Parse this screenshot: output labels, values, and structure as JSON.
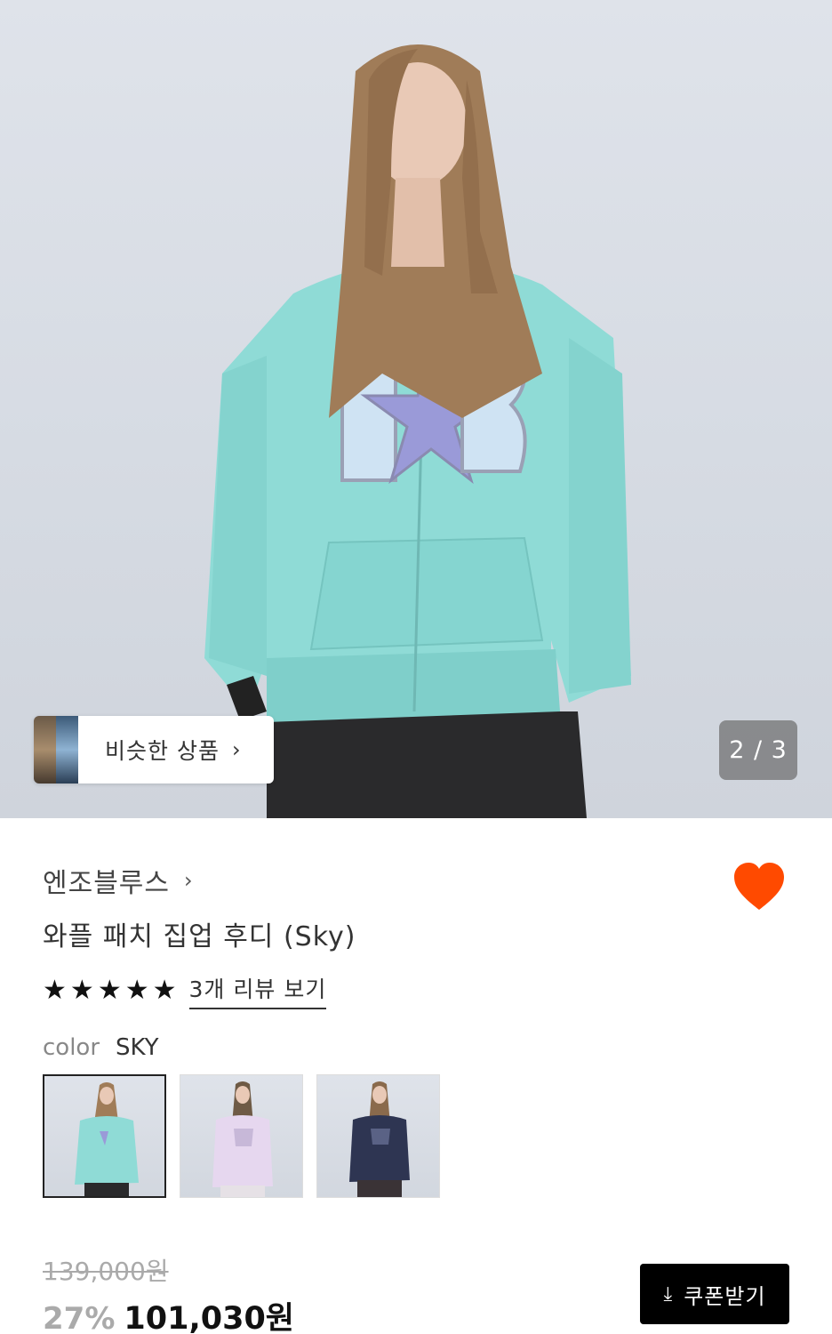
{
  "hero": {
    "similar_label": "비슷한 상품",
    "counter": "2 / 3",
    "icons": {
      "chevron": "chevron-right-icon"
    }
  },
  "product": {
    "brand": "엔조블루스",
    "name": "와플 패치 집업 후디 (Sky)",
    "rating_stars": 5,
    "review_link": "3개 리뷰 보기",
    "wishlist_active": true
  },
  "color": {
    "label": "color",
    "value": "SKY",
    "swatches": [
      {
        "name": "sky",
        "selected": true
      },
      {
        "name": "lavender",
        "selected": false
      },
      {
        "name": "navy",
        "selected": false
      }
    ]
  },
  "price": {
    "original": "139,000원",
    "discount": "27%",
    "sale": "101,030원"
  },
  "coupon": {
    "label": "쿠폰받기"
  },
  "colors": {
    "accent_heart": "#ff4a00",
    "hoodie_sky": "#8fdbd6",
    "button_bg": "#000000"
  }
}
